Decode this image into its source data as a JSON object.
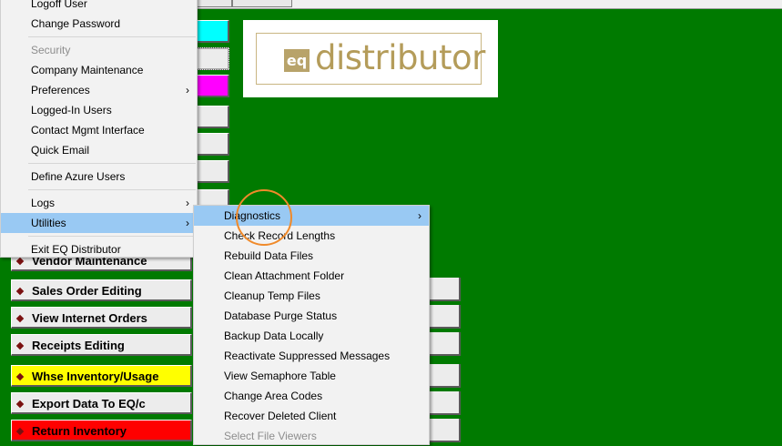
{
  "left_menu": {
    "items": [
      {
        "label": "Logoff User",
        "disabled": false,
        "submenu": false
      },
      {
        "label": "Change Password",
        "disabled": false,
        "submenu": false
      },
      {
        "separator": true
      },
      {
        "label": "Security",
        "disabled": true,
        "submenu": false
      },
      {
        "label": "Company Maintenance",
        "disabled": false,
        "submenu": false
      },
      {
        "label": "Preferences",
        "disabled": false,
        "submenu": true
      },
      {
        "label": "Logged-In Users",
        "disabled": false,
        "submenu": false
      },
      {
        "label": "Contact Mgmt Interface",
        "disabled": false,
        "submenu": false
      },
      {
        "label": "Quick Email",
        "disabled": false,
        "submenu": false
      },
      {
        "separator": true
      },
      {
        "label": "Define Azure Users",
        "disabled": false,
        "submenu": false
      },
      {
        "separator": true
      },
      {
        "label": "Logs",
        "disabled": false,
        "submenu": true
      },
      {
        "label": "Utilities",
        "disabled": false,
        "submenu": true,
        "highlighted": true
      },
      {
        "separator": true
      },
      {
        "label": "Exit EQ Distributor",
        "disabled": false,
        "submenu": false
      }
    ]
  },
  "utilities_menu": {
    "items": [
      {
        "label": "Diagnostics",
        "submenu": true,
        "highlighted": true
      },
      {
        "label": "Check Record Lengths"
      },
      {
        "label": "Rebuild Data Files"
      },
      {
        "label": "Clean Attachment Folder"
      },
      {
        "label": "Cleanup Temp Files"
      },
      {
        "label": "Database Purge Status"
      },
      {
        "label": "Backup Data Locally"
      },
      {
        "label": "Reactivate Suppressed Messages"
      },
      {
        "label": "View Semaphore Table"
      },
      {
        "label": "Change Area Codes"
      },
      {
        "label": "Recover Deleted Client"
      },
      {
        "label": "Select File Viewers",
        "disabled": true
      }
    ]
  },
  "main_buttons": [
    {
      "label": "Vendor Maintenance",
      "color": "#ececec"
    },
    {
      "label": "Sales Order Editing",
      "color": "#ececec"
    },
    {
      "label": "View Internet Orders",
      "color": "#ececec"
    },
    {
      "label": "Receipts Editing",
      "color": "#ececec"
    },
    {
      "label": "Whse Inventory/Usage",
      "color": "#ffff00"
    },
    {
      "label": "Export Data To EQ/c",
      "color": "#ececec"
    },
    {
      "label": "Return Inventory",
      "color": "#ff0000"
    }
  ],
  "logo": {
    "badge": "eq",
    "text": "distributor"
  },
  "colors": {
    "background": "#007a00",
    "menu_highlight": "#99c9f3",
    "logo_gold": "#b49c5a",
    "circle": "#f08a2a"
  },
  "icons": {
    "submenu_arrow": "chevron-right-icon",
    "button_bullet": "diamond-bullet-icon"
  }
}
